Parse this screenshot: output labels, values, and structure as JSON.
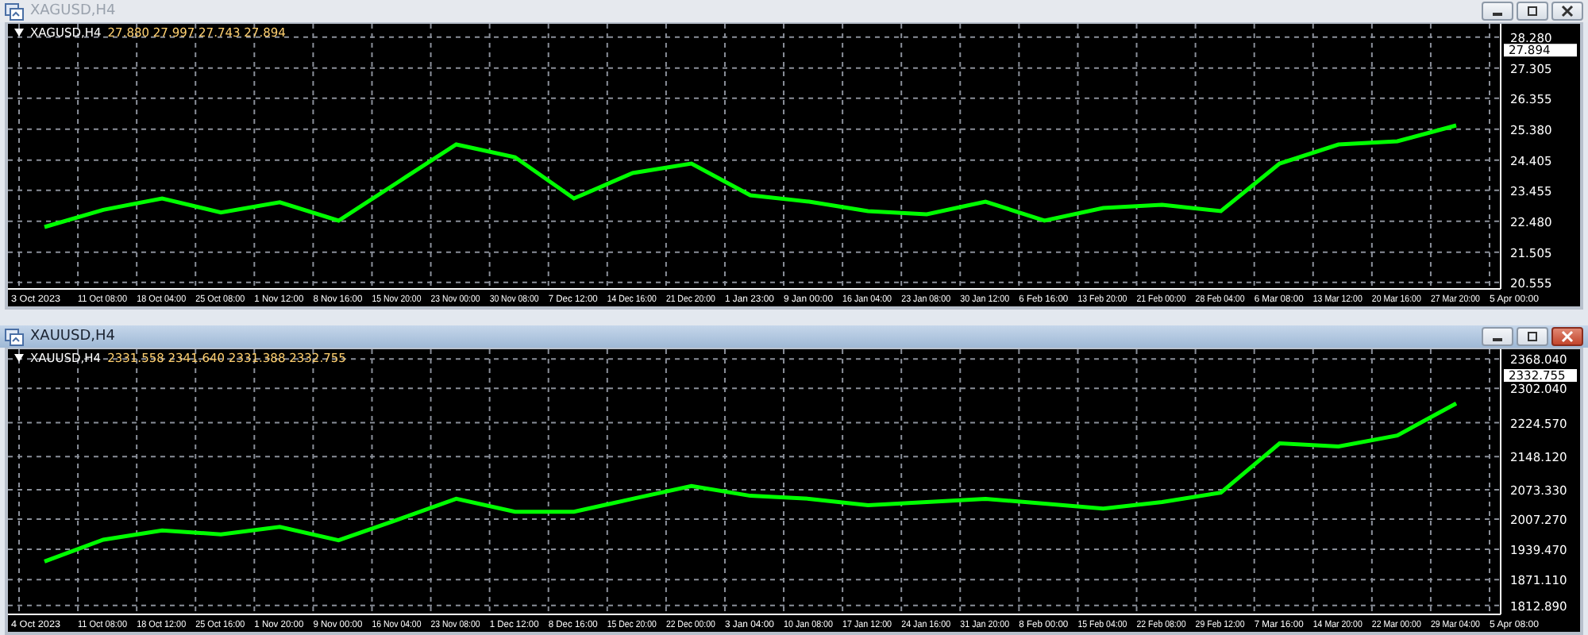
{
  "windows": [
    {
      "title": "XAGUSD,H4",
      "active": false,
      "header": {
        "ohlc": "27.880 27.997 27.743 27.894"
      },
      "current_price": "27.894",
      "chart_data": {
        "type": "line",
        "grid": true,
        "categories": [
          "3 Oct 2023",
          "11 Oct 08:00",
          "18 Oct 04:00",
          "25 Oct 08:00",
          "1 Nov 12:00",
          "8 Nov 16:00",
          "15 Nov 20:00",
          "23 Nov 00:00",
          "30 Nov 08:00",
          "7 Dec 12:00",
          "14 Dec 16:00",
          "21 Dec 20:00",
          "1 Jan 23:00",
          "9 Jan 00:00",
          "16 Jan 04:00",
          "23 Jan 08:00",
          "30 Jan 12:00",
          "6 Feb 16:00",
          "13 Feb 20:00",
          "21 Feb 00:00",
          "28 Feb 04:00",
          "6 Mar 08:00",
          "13 Mar 12:00",
          "20 Mar 16:00",
          "27 Mar 20:00",
          "5 Apr 00:00"
        ],
        "series": [
          {
            "name": "XAGUSD,H4",
            "color": "#00ff00",
            "values": [
              22.3,
              22.84,
              23.2,
              22.76,
              23.08,
              22.5,
              23.7,
              24.9,
              24.5,
              23.2,
              24.0,
              24.3,
              23.3,
              23.1,
              22.8,
              22.7,
              23.1,
              22.5,
              22.9,
              23.0,
              22.8,
              24.3,
              24.9,
              25.0,
              25.5,
              null
            ]
          }
        ],
        "ylim": [
          20.45,
          28.7
        ],
        "yticks": [
          {
            "value": 28.28,
            "label": "28.280"
          },
          {
            "value": 27.305,
            "label": "27.305"
          },
          {
            "value": 26.355,
            "label": "26.355"
          },
          {
            "value": 25.38,
            "label": "25.380"
          },
          {
            "value": 24.405,
            "label": "24.405"
          },
          {
            "value": 23.455,
            "label": "23.455"
          },
          {
            "value": 22.48,
            "label": "22.480"
          },
          {
            "value": 21.505,
            "label": "21.505"
          },
          {
            "value": 20.555,
            "label": "20.555"
          }
        ]
      }
    },
    {
      "title": "XAUUSD,H4",
      "active": true,
      "header": {
        "ohlc": "2331.558 2341.640 2331.388 2332.755"
      },
      "current_price": "2332.755",
      "chart_data": {
        "type": "line",
        "grid": true,
        "categories": [
          "4 Oct 2023",
          "11 Oct 08:00",
          "18 Oct 12:00",
          "25 Oct 16:00",
          "1 Nov 20:00",
          "9 Nov 00:00",
          "16 Nov 04:00",
          "23 Nov 08:00",
          "1 Dec 12:00",
          "8 Dec 16:00",
          "15 Dec 20:00",
          "22 Dec 00:00",
          "3 Jan 04:00",
          "10 Jan 08:00",
          "17 Jan 12:00",
          "24 Jan 16:00",
          "31 Jan 20:00",
          "8 Feb 00:00",
          "15 Feb 04:00",
          "22 Feb 08:00",
          "29 Feb 12:00",
          "7 Mar 16:00",
          "14 Mar 20:00",
          "22 Mar 00:00",
          "29 Mar 04:00",
          "5 Apr 08:00"
        ],
        "series": [
          {
            "name": "XAUUSD,H4",
            "color": "#00ff00",
            "values": [
              1912,
              1961,
              1982,
              1973,
              1990,
              1960,
              2006,
              2053,
              2024,
              2024,
              2053,
              2082,
              2060,
              2053,
              2039,
              2046,
              2053,
              2042,
              2031,
              2046,
              2067,
              2178,
              2171,
              2196,
              2268,
              null
            ]
          }
        ],
        "ylim": [
          1800,
          2390
        ],
        "yticks": [
          {
            "value": 2368.04,
            "label": "2368.040"
          },
          {
            "value": 2302.04,
            "label": "2302.040"
          },
          {
            "value": 2224.57,
            "label": "2224.570"
          },
          {
            "value": 2148.12,
            "label": "2148.120"
          },
          {
            "value": 2073.33,
            "label": "2073.330"
          },
          {
            "value": 2007.27,
            "label": "2007.270"
          },
          {
            "value": 1939.47,
            "label": "1939.470"
          },
          {
            "value": 1871.11,
            "label": "1871.110"
          },
          {
            "value": 1812.89,
            "label": "1812.890"
          }
        ]
      }
    }
  ]
}
